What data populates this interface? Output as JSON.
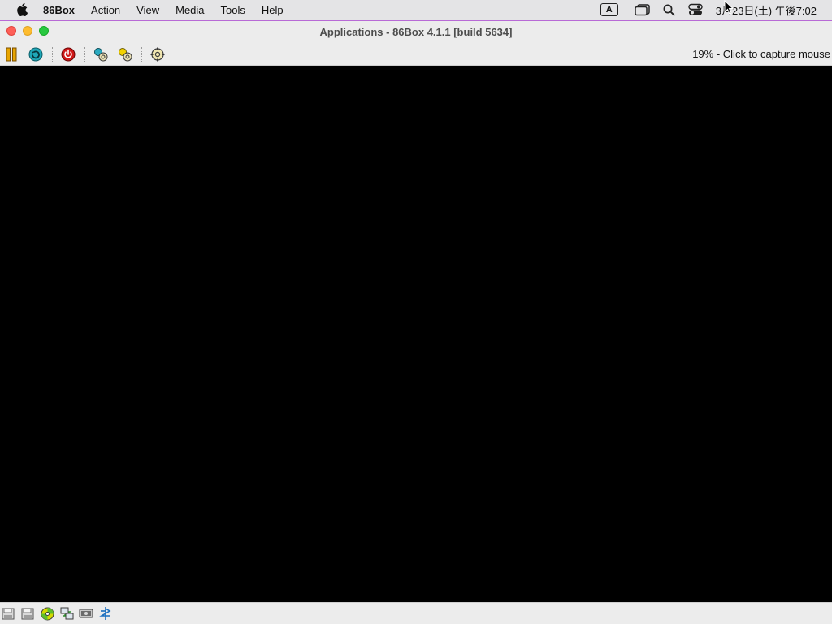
{
  "menubar": {
    "app_name": "86Box",
    "items": [
      "Action",
      "View",
      "Media",
      "Tools",
      "Help"
    ],
    "input_source": "A",
    "clock": "3月23日(土) 午後7:02"
  },
  "window": {
    "title": "Applications - 86Box 4.1.1 [build 5634]",
    "status": "19% - Click to capture mouse"
  },
  "toolbar": {
    "buttons": [
      "pause-icon",
      "ctrl-alt-del-icon",
      "power-icon",
      "settings-icon",
      "hard-reset-icon",
      "machine-config-icon"
    ]
  },
  "statusbar": {
    "icons": [
      "floppy-a-icon",
      "floppy-b-icon",
      "cdrom-icon",
      "network-icon",
      "sound-icon",
      "keyboard-icon"
    ]
  },
  "colors": {
    "menubar_bg": "#e4e4e6",
    "window_chrome": "#ececec",
    "screen_bg": "#000000",
    "accent_border": "#b86ad6"
  }
}
